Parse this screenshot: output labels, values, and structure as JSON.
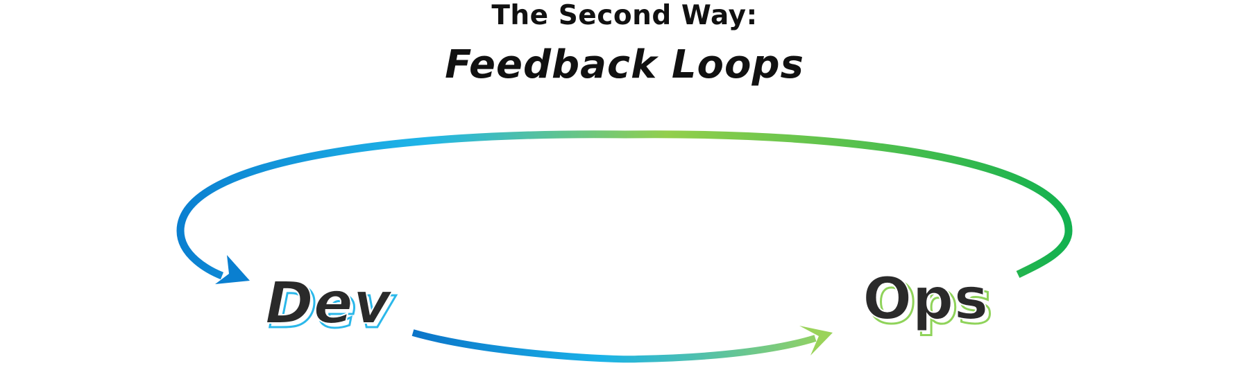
{
  "title": {
    "line1": "The Second Way:",
    "line2": "Feedback Loops"
  },
  "nodes": {
    "dev": {
      "label": "Dev",
      "outline_color": "#2bb8ea"
    },
    "ops": {
      "label": "Ops",
      "outline_color": "#8fd35a"
    }
  },
  "arrows": {
    "feedback_loop": {
      "from": "ops",
      "to": "dev",
      "color_start": "#0a7fd0",
      "color_mid": "#1fb5e8",
      "color_mid2": "#93cf4c",
      "color_end": "#13b14f"
    },
    "flow": {
      "from": "dev",
      "to": "ops",
      "color_start": "#0b74c8",
      "color_mid": "#1ab2e8",
      "color_end": "#9ad35a"
    }
  }
}
